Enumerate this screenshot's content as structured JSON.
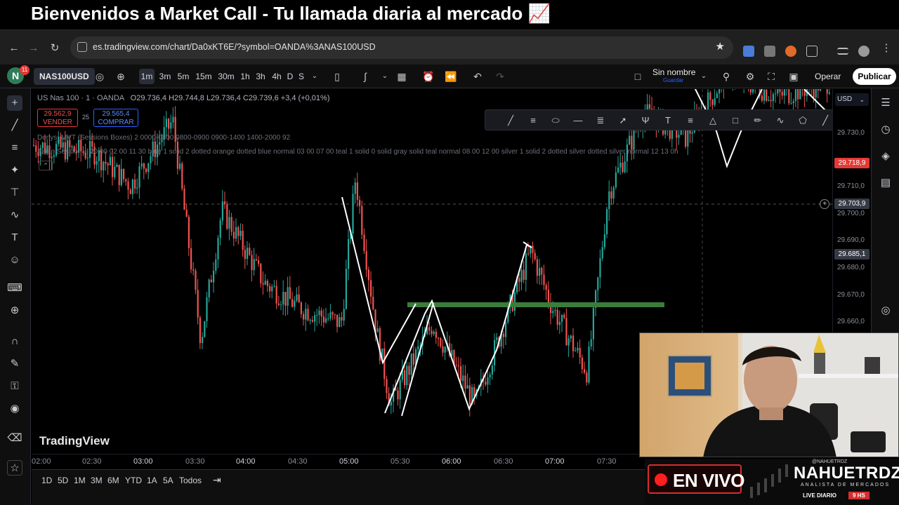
{
  "banner": {
    "title": "Bienvenidos a Market Call - Tu llamada diaria al mercado 📈"
  },
  "browser": {
    "url": "es.tradingview.com/chart/Da0xKT6E/?symbol=OANDA%3ANAS100USD",
    "back_icon": "arrow-left-icon",
    "forward_icon": "arrow-right-icon",
    "reload_icon": "reload-icon",
    "bookmark_icon": "star-icon"
  },
  "tv_toolbar": {
    "logo": "N",
    "notifications": "11",
    "symbol": "NAS100USD",
    "intervals": [
      "1m",
      "3m",
      "5m",
      "15m",
      "30m",
      "1h",
      "3h",
      "4h",
      "D",
      "S"
    ],
    "selected_interval": "1m",
    "layout_name": "Sin nombre",
    "layout_sub": "Guardar",
    "trade_label": "Operar",
    "publish_label": "Publicar"
  },
  "legend": {
    "symbol_line": "US Nas 100 · 1 · OANDA",
    "open": "O29.736,4",
    "high": "H29.744,8",
    "low": "L29.736,4",
    "close": "C29.739,6",
    "change": "+3,4 (+0,01%)",
    "sell_price": "29.562,9",
    "sell_label": "VENDER",
    "spread": "25",
    "buy_price": "29.565,4",
    "buy_label": "COMPRAR",
    "indicator1": "Denys_MVT (Sessions Boxes) 2 0000-0800 0800-0900 0900-1400 1400-2000 92",
    "indicator2": "Asian Session  ⌂  20 00 02 00 11 30 blue 1 solid 2 dotted orange dotted blue normal 03 00 07 00 teal 1 solid 0 solid gray solid teal normal 08 00 12 00 silver 1 solid 2 dotted silver dotted silver normal 12 13 0h",
    "collapse_label": "⌃"
  },
  "price_axis": {
    "currency": "USD",
    "labels": [
      "29.730,0",
      "29.720,0",
      "29.710,0",
      "29.700,0",
      "29.690,0",
      "29.680,0",
      "29.670,0",
      "29.660,0"
    ],
    "tag_red": "29.718,9",
    "tag_cross": "29.703,9",
    "tag_gray": "29.685,1"
  },
  "time_axis": {
    "labels": [
      "02:00",
      "02:30",
      "03:00",
      "03:30",
      "04:00",
      "04:30",
      "05:00",
      "05:30",
      "06:00",
      "06:30",
      "07:00",
      "07:30"
    ]
  },
  "ranges": [
    "1D",
    "5D",
    "1M",
    "3M",
    "6M",
    "YTD",
    "1A",
    "5A",
    "Todos"
  ],
  "watermark": "TradingView",
  "overlay": {
    "live_label": "EN VIVO",
    "brand_name": "NAHUETRDZ",
    "brand_sub": "ANALISTA DE MERCADOS",
    "brand_handle": "@NAHUETRDZ",
    "brand_live": "LIVE DIARIO",
    "brand_hours": "9 HS"
  },
  "chart_data": {
    "type": "candlestick",
    "x_labels": [
      "02:00",
      "02:30",
      "03:00",
      "03:30",
      "04:00",
      "04:30",
      "05:00",
      "05:30",
      "06:00",
      "06:30",
      "07:00",
      "07:30"
    ],
    "y_ticks": [
      29730,
      29720,
      29710,
      29700,
      29690,
      29680,
      29670,
      29660
    ],
    "ylim": [
      29645,
      29735
    ],
    "support_level": 29668,
    "colors": {
      "up": "#26a69a",
      "down": "#ef5350",
      "level": "#3a7d3a"
    }
  }
}
